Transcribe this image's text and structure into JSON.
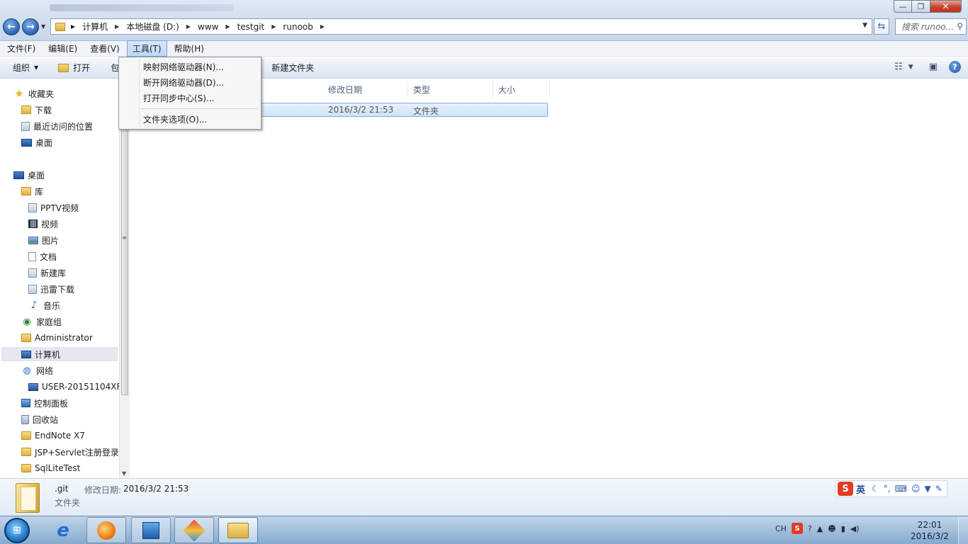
{
  "address": {
    "crumbs": [
      "计算机",
      "本地磁盘 (D:)",
      "www",
      "testgit",
      "runoob"
    ],
    "search_placeholder": "搜索 runoo..."
  },
  "window_controls": {
    "minimize": "—",
    "maximize": "❐",
    "close": "✕"
  },
  "menubar": {
    "items": [
      "文件(F)",
      "编辑(E)",
      "查看(V)",
      "工具(T)",
      "帮助(H)"
    ],
    "active_index": 3
  },
  "toolbar": {
    "organize": "组织",
    "open": "打开",
    "partial": "包",
    "new_folder": "新建文件夹",
    "help": "?"
  },
  "tools_menu": {
    "items": [
      "映射网络驱动器(N)...",
      "断开网络驱动器(D)...",
      "打开同步中心(S)...",
      "文件夹选项(O)..."
    ]
  },
  "nav": {
    "items": [
      {
        "label": "收藏夹",
        "icon": "star-icon"
      },
      {
        "label": "下载",
        "icon": "download-folder-icon"
      },
      {
        "label": "最近访问的位置",
        "icon": "recent-places-icon"
      },
      {
        "label": "桌面",
        "icon": "desktop-icon"
      },
      {
        "label": "桌面",
        "icon": "desktop-icon"
      },
      {
        "label": "库",
        "icon": "library-icon"
      },
      {
        "label": "PPTV视频",
        "icon": "library-icon"
      },
      {
        "label": "视频",
        "icon": "video-icon"
      },
      {
        "label": "图片",
        "icon": "picture-icon"
      },
      {
        "label": "文档",
        "icon": "document-icon"
      },
      {
        "label": "新建库",
        "icon": "library-icon"
      },
      {
        "label": "迅雷下载",
        "icon": "library-icon"
      },
      {
        "label": "音乐",
        "icon": "music-icon"
      },
      {
        "label": "家庭组",
        "icon": "homegroup-icon"
      },
      {
        "label": "Administrator",
        "icon": "user-folder-icon"
      },
      {
        "label": "计算机",
        "icon": "computer-icon"
      },
      {
        "label": "网络",
        "icon": "network-icon"
      },
      {
        "label": "USER-20151104XF",
        "icon": "computer-icon"
      },
      {
        "label": "控制面板",
        "icon": "control-panel-icon"
      },
      {
        "label": "回收站",
        "icon": "recycle-bin-icon"
      },
      {
        "label": "EndNote X7",
        "icon": "folder-icon"
      },
      {
        "label": "JSP+Servlet注册登录",
        "icon": "folder-icon"
      },
      {
        "label": "SqlLiteTest",
        "icon": "folder-icon"
      }
    ],
    "selected_index": 15
  },
  "filelist": {
    "columns": [
      "修改日期",
      "类型",
      "大小"
    ],
    "rows": [
      {
        "modified": "2016/3/2 21:53",
        "type": "文件夹",
        "size": ""
      }
    ]
  },
  "details": {
    "name": ".git",
    "modified_label": "修改日期:",
    "modified_value": "2016/3/2 21:53",
    "type": "文件夹"
  },
  "ime": {
    "logo": "S",
    "mode": "英"
  },
  "tray": {
    "lang": "CH",
    "sogou": "S",
    "help": "?"
  },
  "clock": {
    "time": "22:01",
    "date": "2016/3/2"
  }
}
